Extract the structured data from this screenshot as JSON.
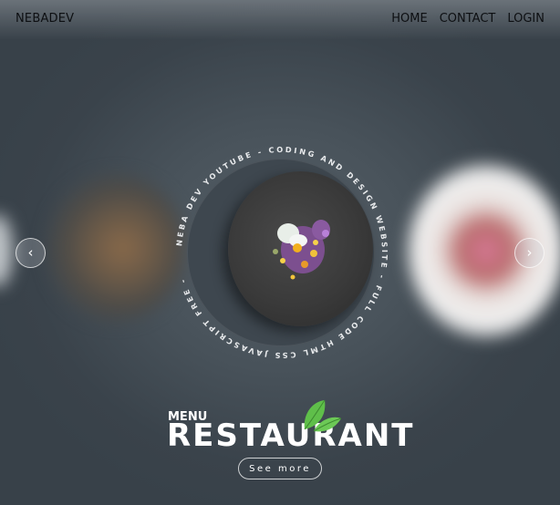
{
  "brand": {
    "logo": "NEBADEV"
  },
  "nav": {
    "items": [
      "HOME",
      "CONTACT",
      "LOGIN"
    ]
  },
  "hero": {
    "circular_text": "NEBA DEV YOUTUBE - CODING AND DESIGN WEBSITE - FULL CODE HTML CSS JAVASCRIPT FREE - ",
    "menu_label": "MENU",
    "title": "RESTAURANT",
    "cta_label": "See more"
  },
  "carousel": {
    "prev_icon": "chevron-left-icon",
    "next_icon": "chevron-right-icon",
    "prev_glyph": "‹",
    "next_glyph": "›"
  },
  "colors": {
    "background": "#3a434b",
    "text_dark": "#0d0f12",
    "text_light": "#ffffff",
    "leaf_green": "#5fbf4a"
  }
}
